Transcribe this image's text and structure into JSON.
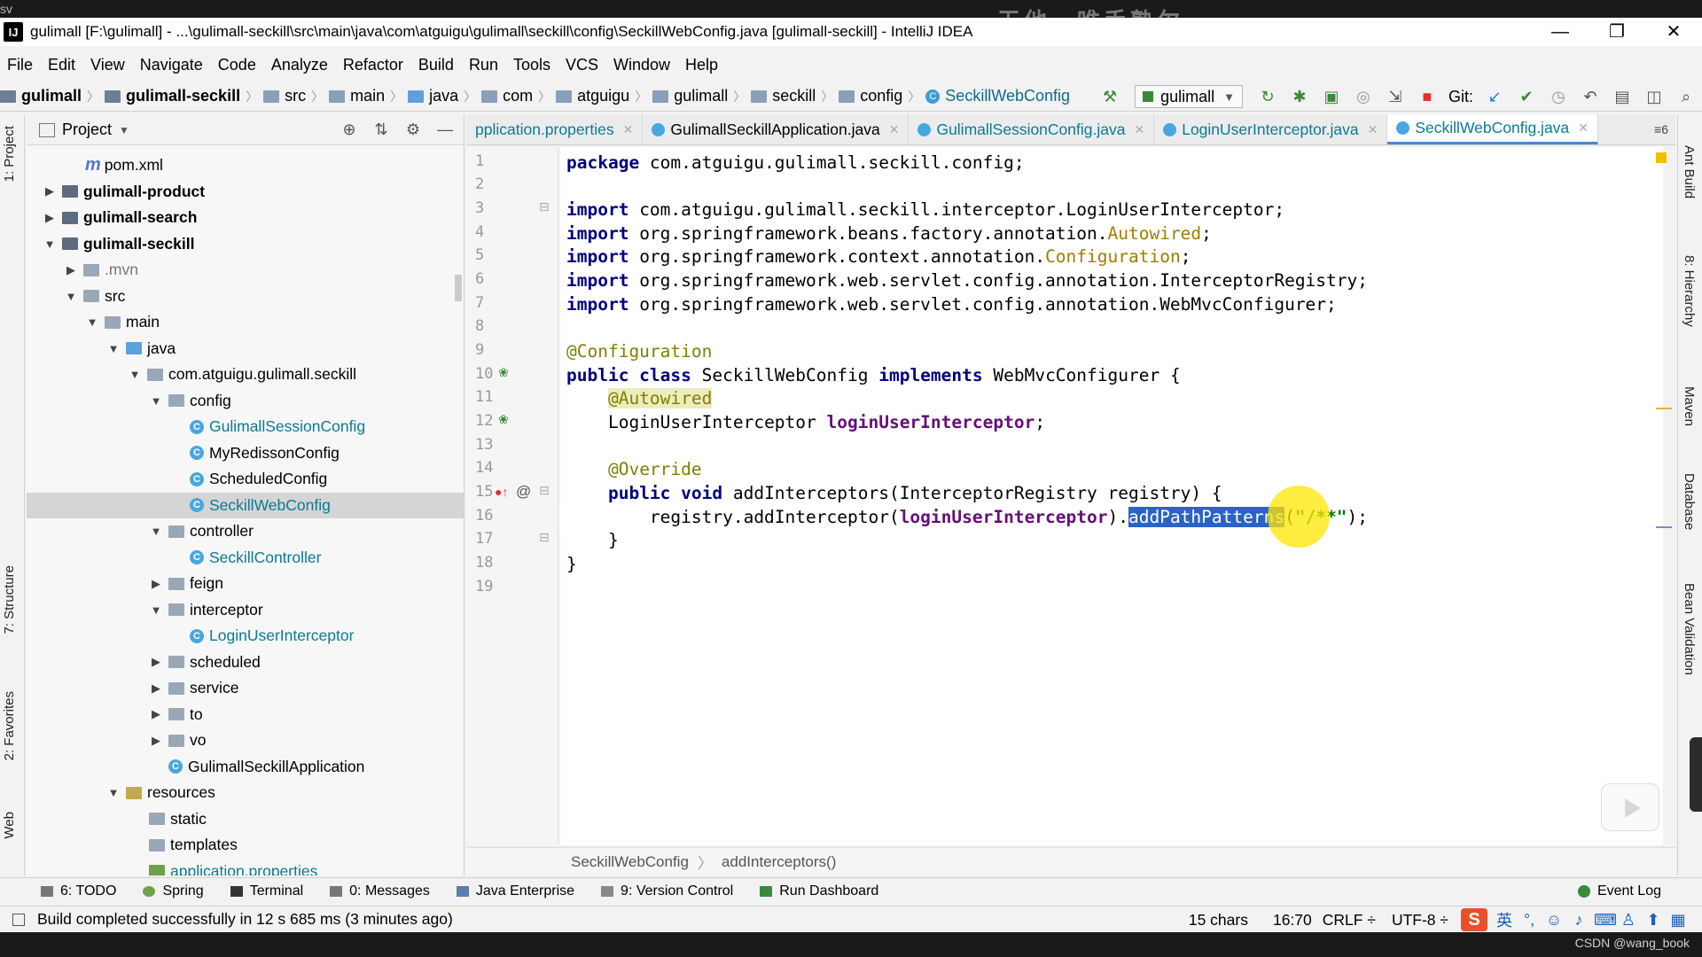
{
  "window": {
    "title": "gulimall [F:\\gulimall] - ...\\gulimall-seckill\\src\\main\\java\\com\\atguigu\\gulimall\\seckill\\config\\SeckillWebConfig.java [gulimall-seckill] - IntelliJ IDEA",
    "overlay_watermark": "无他，唯手熟尔",
    "top_left_text": "sv",
    "app_icon_text": "IJ",
    "min_glyph": "—",
    "max_glyph": "❐",
    "close_glyph": "✕"
  },
  "menu": [
    "File",
    "Edit",
    "View",
    "Navigate",
    "Code",
    "Analyze",
    "Refactor",
    "Build",
    "Run",
    "Tools",
    "VCS",
    "Window",
    "Help"
  ],
  "navbar": {
    "crumbs": [
      "gulimall",
      "gulimall-seckill",
      "src",
      "main",
      "java",
      "com",
      "atguigu",
      "gulimall",
      "seckill",
      "config",
      "SeckillWebConfig"
    ],
    "run_config": "gulimall",
    "git_label": "Git:"
  },
  "project_panel": {
    "title": "Project",
    "items": [
      {
        "label": "pom.xml"
      },
      {
        "label": "gulimall-product"
      },
      {
        "label": "gulimall-search"
      },
      {
        "label": "gulimall-seckill"
      },
      {
        "label": ".mvn"
      },
      {
        "label": "src"
      },
      {
        "label": "main"
      },
      {
        "label": "java"
      },
      {
        "label": "com.atguigu.gulimall.seckill"
      },
      {
        "label": "config"
      },
      {
        "label": "GulimallSessionConfig"
      },
      {
        "label": "MyRedissonConfig"
      },
      {
        "label": "ScheduledConfig"
      },
      {
        "label": "SeckillWebConfig"
      },
      {
        "label": "controller"
      },
      {
        "label": "SeckillController"
      },
      {
        "label": "feign"
      },
      {
        "label": "interceptor"
      },
      {
        "label": "LoginUserInterceptor"
      },
      {
        "label": "scheduled"
      },
      {
        "label": "service"
      },
      {
        "label": "to"
      },
      {
        "label": "vo"
      },
      {
        "label": "GulimallSeckillApplication"
      },
      {
        "label": "resources"
      },
      {
        "label": "static"
      },
      {
        "label": "templates"
      },
      {
        "label": "application.properties"
      }
    ]
  },
  "left_tabs": [
    "1: Project",
    "7: Structure",
    "2: Favorites",
    "Web"
  ],
  "right_tabs": [
    "Ant Build",
    "8: Hierarchy",
    "Maven",
    "Database",
    "Bean Validation"
  ],
  "editor_tabs": [
    {
      "label": "pplication.properties"
    },
    {
      "label": "GulimallSeckillApplication.java"
    },
    {
      "label": "GulimallSessionConfig.java"
    },
    {
      "label": "LoginUserInterceptor.java"
    },
    {
      "label": "SeckillWebConfig.java",
      "active": true
    }
  ],
  "editor_tab_more": "≡6",
  "line_numbers": [
    "1",
    "2",
    "3",
    "4",
    "5",
    "6",
    "7",
    "8",
    "9",
    "10",
    "11",
    "12",
    "13",
    "14",
    "15",
    "16",
    "17",
    "18",
    "19"
  ],
  "code": {
    "l1_kw": "package",
    "l1_rest": " com.atguigu.gulimall.seckill.config;",
    "import_kw": "import",
    "l3_rest": " com.atguigu.gulimall.seckill.interceptor.LoginUserInterceptor;",
    "l4_a": " org.springframework.beans.factory.annotation.",
    "l4_b": "Autowired",
    "l5_a": " org.springframework.context.annotation.",
    "l5_b": "Configuration",
    "l6_rest": " org.springframework.web.servlet.config.annotation.InterceptorRegistry;",
    "l7_rest": " org.springframework.web.servlet.config.annotation.WebMvcConfigurer;",
    "l9": "@Configuration",
    "l10_kw1": "public class",
    "l10_a": " SeckillWebConfig ",
    "l10_kw2": "implements",
    "l10_b": " WebMvcConfigurer {",
    "l11": "@Autowired",
    "l12_a": "LoginUserInterceptor ",
    "l12_b": "loginUserInterceptor",
    "l14": "@Override",
    "l15_kw": "public void",
    "l15_rest": " addInterceptors(InterceptorRegistry registry) {",
    "l16_a": "registry.addInterceptor(",
    "l16_b": "loginUserInterceptor",
    "l16_c": ").",
    "l16_sel": "addPathPatterns",
    "l16_d": "(",
    "l16_str": "\"/**\"",
    "l16_e": ");",
    "l17": "}",
    "l18": "}"
  },
  "editor_breadcrumb": [
    "SeckillWebConfig",
    "addInterceptors()"
  ],
  "bottom_tools": [
    "6: TODO",
    "Spring",
    "Terminal",
    "0: Messages",
    "Java Enterprise",
    "9: Version Control",
    "Run Dashboard"
  ],
  "event_log": "Event Log",
  "status": {
    "message": "Build completed successfully in 12 s 685 ms (3 minutes ago)",
    "chars": "15 chars",
    "position": "16:70",
    "line_sep": "CRLF ÷",
    "encoding": "UTF-8 ÷",
    "ime_lang": "英"
  },
  "footer_credit": "CSDN @wang_book"
}
